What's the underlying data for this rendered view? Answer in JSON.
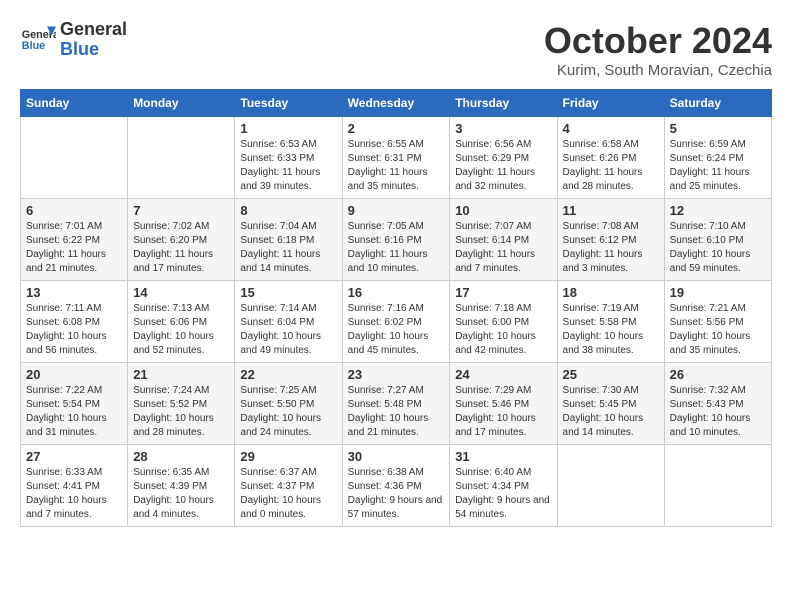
{
  "header": {
    "logo_line1": "General",
    "logo_line2": "Blue",
    "month": "October 2024",
    "location": "Kurim, South Moravian, Czechia"
  },
  "weekdays": [
    "Sunday",
    "Monday",
    "Tuesday",
    "Wednesday",
    "Thursday",
    "Friday",
    "Saturday"
  ],
  "weeks": [
    [
      {
        "day": "",
        "info": ""
      },
      {
        "day": "",
        "info": ""
      },
      {
        "day": "1",
        "info": "Sunrise: 6:53 AM\nSunset: 6:33 PM\nDaylight: 11 hours and 39 minutes."
      },
      {
        "day": "2",
        "info": "Sunrise: 6:55 AM\nSunset: 6:31 PM\nDaylight: 11 hours and 35 minutes."
      },
      {
        "day": "3",
        "info": "Sunrise: 6:56 AM\nSunset: 6:29 PM\nDaylight: 11 hours and 32 minutes."
      },
      {
        "day": "4",
        "info": "Sunrise: 6:58 AM\nSunset: 6:26 PM\nDaylight: 11 hours and 28 minutes."
      },
      {
        "day": "5",
        "info": "Sunrise: 6:59 AM\nSunset: 6:24 PM\nDaylight: 11 hours and 25 minutes."
      }
    ],
    [
      {
        "day": "6",
        "info": "Sunrise: 7:01 AM\nSunset: 6:22 PM\nDaylight: 11 hours and 21 minutes."
      },
      {
        "day": "7",
        "info": "Sunrise: 7:02 AM\nSunset: 6:20 PM\nDaylight: 11 hours and 17 minutes."
      },
      {
        "day": "8",
        "info": "Sunrise: 7:04 AM\nSunset: 6:18 PM\nDaylight: 11 hours and 14 minutes."
      },
      {
        "day": "9",
        "info": "Sunrise: 7:05 AM\nSunset: 6:16 PM\nDaylight: 11 hours and 10 minutes."
      },
      {
        "day": "10",
        "info": "Sunrise: 7:07 AM\nSunset: 6:14 PM\nDaylight: 11 hours and 7 minutes."
      },
      {
        "day": "11",
        "info": "Sunrise: 7:08 AM\nSunset: 6:12 PM\nDaylight: 11 hours and 3 minutes."
      },
      {
        "day": "12",
        "info": "Sunrise: 7:10 AM\nSunset: 6:10 PM\nDaylight: 10 hours and 59 minutes."
      }
    ],
    [
      {
        "day": "13",
        "info": "Sunrise: 7:11 AM\nSunset: 6:08 PM\nDaylight: 10 hours and 56 minutes."
      },
      {
        "day": "14",
        "info": "Sunrise: 7:13 AM\nSunset: 6:06 PM\nDaylight: 10 hours and 52 minutes."
      },
      {
        "day": "15",
        "info": "Sunrise: 7:14 AM\nSunset: 6:04 PM\nDaylight: 10 hours and 49 minutes."
      },
      {
        "day": "16",
        "info": "Sunrise: 7:16 AM\nSunset: 6:02 PM\nDaylight: 10 hours and 45 minutes."
      },
      {
        "day": "17",
        "info": "Sunrise: 7:18 AM\nSunset: 6:00 PM\nDaylight: 10 hours and 42 minutes."
      },
      {
        "day": "18",
        "info": "Sunrise: 7:19 AM\nSunset: 5:58 PM\nDaylight: 10 hours and 38 minutes."
      },
      {
        "day": "19",
        "info": "Sunrise: 7:21 AM\nSunset: 5:56 PM\nDaylight: 10 hours and 35 minutes."
      }
    ],
    [
      {
        "day": "20",
        "info": "Sunrise: 7:22 AM\nSunset: 5:54 PM\nDaylight: 10 hours and 31 minutes."
      },
      {
        "day": "21",
        "info": "Sunrise: 7:24 AM\nSunset: 5:52 PM\nDaylight: 10 hours and 28 minutes."
      },
      {
        "day": "22",
        "info": "Sunrise: 7:25 AM\nSunset: 5:50 PM\nDaylight: 10 hours and 24 minutes."
      },
      {
        "day": "23",
        "info": "Sunrise: 7:27 AM\nSunset: 5:48 PM\nDaylight: 10 hours and 21 minutes."
      },
      {
        "day": "24",
        "info": "Sunrise: 7:29 AM\nSunset: 5:46 PM\nDaylight: 10 hours and 17 minutes."
      },
      {
        "day": "25",
        "info": "Sunrise: 7:30 AM\nSunset: 5:45 PM\nDaylight: 10 hours and 14 minutes."
      },
      {
        "day": "26",
        "info": "Sunrise: 7:32 AM\nSunset: 5:43 PM\nDaylight: 10 hours and 10 minutes."
      }
    ],
    [
      {
        "day": "27",
        "info": "Sunrise: 6:33 AM\nSunset: 4:41 PM\nDaylight: 10 hours and 7 minutes."
      },
      {
        "day": "28",
        "info": "Sunrise: 6:35 AM\nSunset: 4:39 PM\nDaylight: 10 hours and 4 minutes."
      },
      {
        "day": "29",
        "info": "Sunrise: 6:37 AM\nSunset: 4:37 PM\nDaylight: 10 hours and 0 minutes."
      },
      {
        "day": "30",
        "info": "Sunrise: 6:38 AM\nSunset: 4:36 PM\nDaylight: 9 hours and 57 minutes."
      },
      {
        "day": "31",
        "info": "Sunrise: 6:40 AM\nSunset: 4:34 PM\nDaylight: 9 hours and 54 minutes."
      },
      {
        "day": "",
        "info": ""
      },
      {
        "day": "",
        "info": ""
      }
    ]
  ]
}
